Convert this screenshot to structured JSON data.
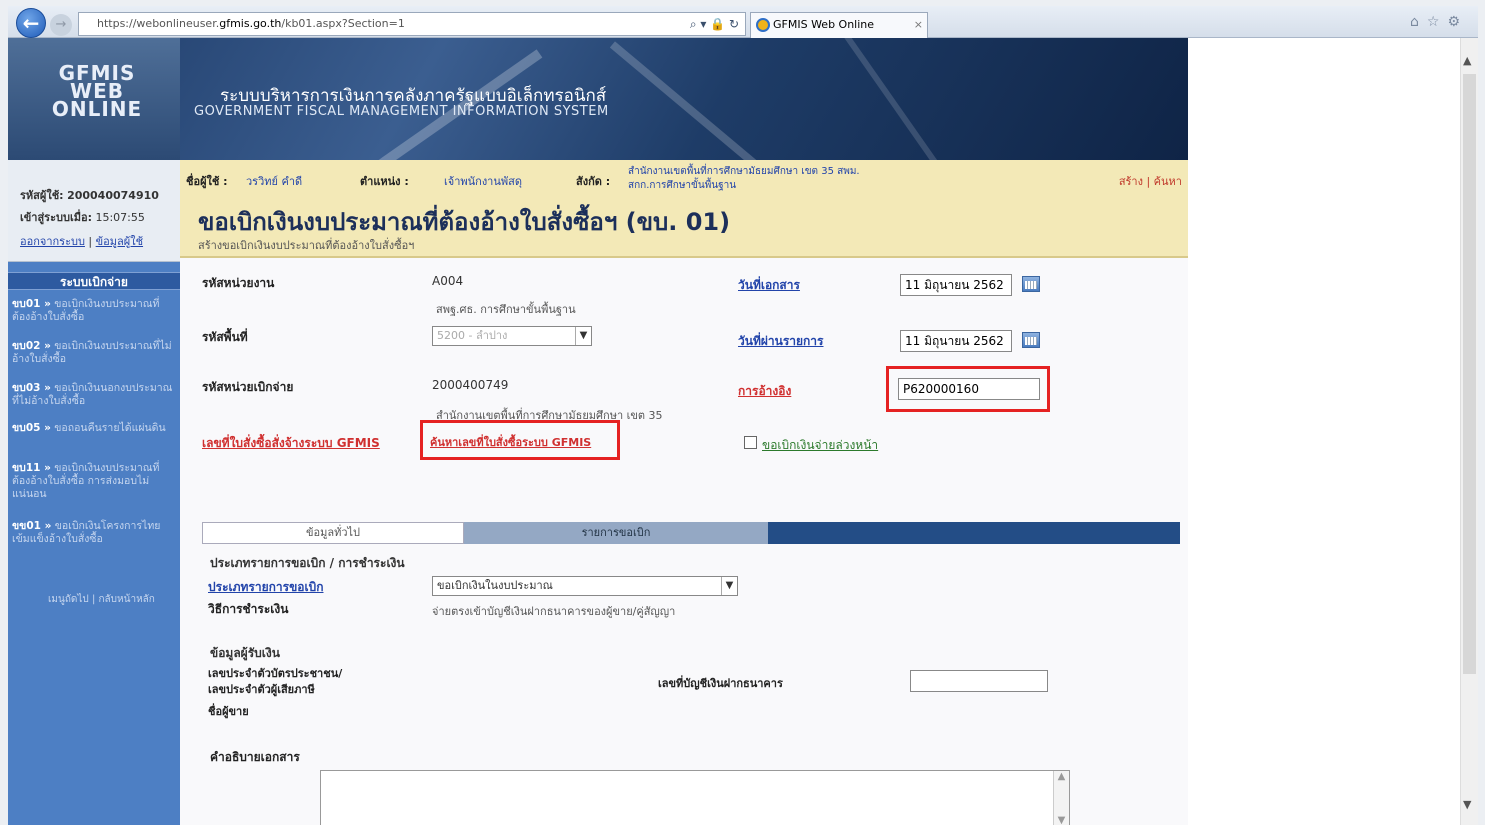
{
  "browser": {
    "url_prefix": "https://webonlineuser.",
    "url_host": "gfmis.go.th",
    "url_rest": "/kb01.aspx?Section=1",
    "tab_title": "GFMIS Web Online"
  },
  "header": {
    "logo_line1": "GFMIS",
    "logo_line2": "WEB ONLINE",
    "system_th": "ระบบบริหารการเงินการคลังภาครัฐแบบอิเล็กทรอนิกส์",
    "system_en": "GOVERNMENT FISCAL MANAGEMENT INFORMATION SYSTEM"
  },
  "user": {
    "user_label": "รหัสผู้ใช้:",
    "user_id": "200040074910",
    "login_label": "เข้าสู่ระบบเมื่อ:",
    "login_time": "15:07:55",
    "logout": "ออกจากระบบ",
    "profile": "ข้อมูลผู้ใช้"
  },
  "topline": {
    "user_name_label": "ชื่อผู้ใช้ :",
    "user_name": "วรวิทย์ คำดี",
    "position_label": "ตำแหน่ง :",
    "position": "เจ้าพนักงานพัสดุ",
    "affiliation_label": "สังกัด :",
    "affiliation_line1": "สำนักงานเขตพื้นที่การศึกษามัธยมศึกษา เขต 35 สพม.",
    "affiliation_line2": "สกก.การศึกษาขั้นพื้นฐาน",
    "actions": "สร้าง | ค้นหา"
  },
  "page": {
    "title": "ขอเบิกเงินงบประมาณที่ต้องอ้างใบสั่งซื้อฯ (ขบ. 01)",
    "subtitle": "สร้างขอเบิกเงินงบประมาณที่ต้องอ้างใบสั่งซื้อฯ"
  },
  "menu": {
    "title": "ระบบเบิกจ่าย",
    "items": [
      {
        "code": "ขบ01 »",
        "label": "ขอเบิกเงินงบประมาณที่ต้องอ้างใบสั่งซื้อ"
      },
      {
        "code": "ขบ02 »",
        "label": "ขอเบิกเงินงบประมาณที่ไม่อ้างใบสั่งซื้อ"
      },
      {
        "code": "ขบ03 »",
        "label": "ขอเบิกเงินนอกงบประมาณที่ไม่อ้างใบสั่งซื้อ"
      },
      {
        "code": "ขบ05 »",
        "label": "ขอถอนคืนรายได้แผ่นดิน"
      },
      {
        "code": "ขบ11 »",
        "label": "ขอเบิกเงินงบประมาณที่ต้องอ้างใบสั่งซื้อ การส่งมอบไม่แน่นอน"
      },
      {
        "code": "ขข01 »",
        "label": "ขอเบิกเงินโครงการไทยเข้มแข็งอ้างใบสั่งซื้อ"
      }
    ],
    "footer": "เมนูถัดไป | กลับหน้าหลัก"
  },
  "form": {
    "dept_label": "รหัสหน่วยงาน",
    "dept_code": "A004",
    "dept_name": "สพฐ.ศธ. การศึกษาขั้นพื้นฐาน",
    "area_label": "รหัสพื้นที่",
    "area_value": "5200 - ลำปาง",
    "disb_label": "รหัสหน่วยเบิกจ่าย",
    "disb_code": "2000400749",
    "disb_name": "สำนักงานเขตพื้นที่การศึกษามัธยมศึกษา เขต 35",
    "po_link": "เลขที่ใบสั่งซื้อสั่งจ้างระบบ GFMIS",
    "po_search": "ค้นหาเลขที่ใบสั่งซื้อระบบ GFMIS",
    "doc_date_label": "วันที่เอกสาร",
    "doc_date": "11 มิถุนายน 2562",
    "post_date_label": "วันที่ผ่านรายการ",
    "post_date": "11 มิถุนายน 2562",
    "ref_label": "การอ้างอิง",
    "ref_value": "P620000160",
    "advance_label": "ขอเบิกเงินจ่ายล่วงหน้า"
  },
  "tabs": {
    "general": "ข้อมูลทั่วไป",
    "items": "รายการขอเบิก"
  },
  "details": {
    "section1": "ประเภทรายการขอเบิก / การชำระเงิน",
    "type_link": "ประเภทรายการขอเบิก",
    "type_value": "ขอเบิกเงินในงบประมาณ",
    "payment_label": "วิธีการชำระเงิน",
    "payment_value": "จ่ายตรงเข้าบัญชีเงินฝากธนาคารของผู้ขาย/คู่สัญญา",
    "section2": "ข้อมูลผู้รับเงิน",
    "citizen_label": "เลขประจำตัวบัตรประชาชน/",
    "tax_label": "เลขประจำตัวผู้เสียภาษี",
    "vendor_label": "ชื่อผู้ขาย",
    "bank_label": "เลขที่บัญชีเงินฝากธนาคาร",
    "desc_label": "คำอธิบายเอกสาร"
  }
}
